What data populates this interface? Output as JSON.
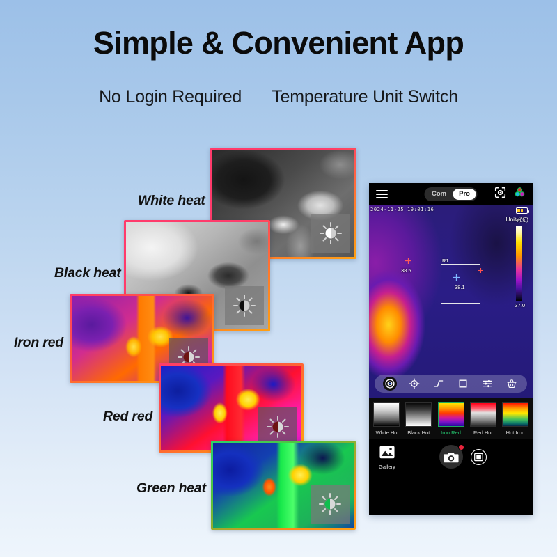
{
  "header": {
    "title": "Simple & Convenient App",
    "feature_left": "No Login Required",
    "feature_right": "Temperature Unit Switch"
  },
  "palette_cards": [
    {
      "label": "White heat",
      "icon": "brightness-icon"
    },
    {
      "label": "Black heat",
      "icon": "brightness-icon"
    },
    {
      "label": "Iron red",
      "icon": "brightness-icon"
    },
    {
      "label": "Red red",
      "icon": "brightness-icon"
    },
    {
      "label": "Green heat",
      "icon": "brightness-icon"
    }
  ],
  "phone": {
    "app_bar": {
      "menu_icon": "hamburger-menu-icon",
      "mode_options": [
        "Com",
        "Pro"
      ],
      "mode_selected": "Pro",
      "focus_icon": "focus-frame-icon",
      "palette_icon": "color-palette-icon"
    },
    "viewport": {
      "timestamp": "2024-11-25 19:01:16",
      "battery_icon": "battery-icon",
      "unit_label": "Unit (℃)",
      "scale_high": "44.1",
      "scale_low": "37.0",
      "spot_temp": "38.5",
      "roi_name": "R1",
      "roi_temp": "38.1"
    },
    "tools": [
      {
        "name": "spot-measure-icon",
        "selected": true
      },
      {
        "name": "center-target-icon",
        "selected": false
      },
      {
        "name": "line-profile-icon",
        "selected": false
      },
      {
        "name": "area-box-icon",
        "selected": false
      },
      {
        "name": "settings-sliders-icon",
        "selected": false
      },
      {
        "name": "delete-basket-icon",
        "selected": false
      }
    ],
    "palettes": [
      {
        "name": "White Ho",
        "selected": false
      },
      {
        "name": "Black Hot",
        "selected": false
      },
      {
        "name": "Iron Red",
        "selected": true
      },
      {
        "name": "Red Hot",
        "selected": false
      },
      {
        "name": "Hot Iron",
        "selected": false
      }
    ],
    "bottom_bar": {
      "gallery_label": "Gallery",
      "gallery_icon": "gallery-image-icon",
      "shutter_icon": "camera-shutter-icon",
      "recording_badge": "record-dot-badge",
      "pip_icon": "picture-in-picture-icon"
    }
  },
  "colors": {
    "accent_green": "#24c46e",
    "record_red": "#e8243c",
    "card_border_top": "#ff3b6b",
    "card_border_bottom": "#ff9a12",
    "background_top": "#9cc0e8",
    "background_bottom": "#eef5fc"
  }
}
